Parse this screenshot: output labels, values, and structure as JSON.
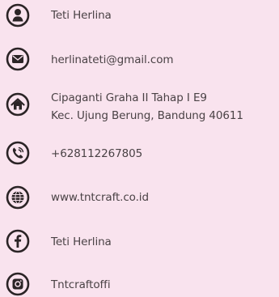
{
  "contacts": {
    "name": "Teti Herlina",
    "email": "herlinateti@gmail.com",
    "address_line1": "Cipaganti Graha II Tahap I E9",
    "address_line2": "Kec. Ujung Berung, Bandung 40611",
    "phone": "+628112267805",
    "website": "www.tntcraft.co.id",
    "facebook": "Teti Herlina",
    "instagram": "Tntcraftoffi"
  },
  "icons": {
    "name": "person-icon",
    "email": "envelope-icon",
    "address": "home-icon",
    "phone": "phone-icon",
    "website": "globe-icon",
    "facebook": "facebook-icon",
    "instagram": "instagram-icon"
  },
  "colors": {
    "background": "#f9e3ee",
    "icon": "#2b2426",
    "text": "#4a4245"
  }
}
